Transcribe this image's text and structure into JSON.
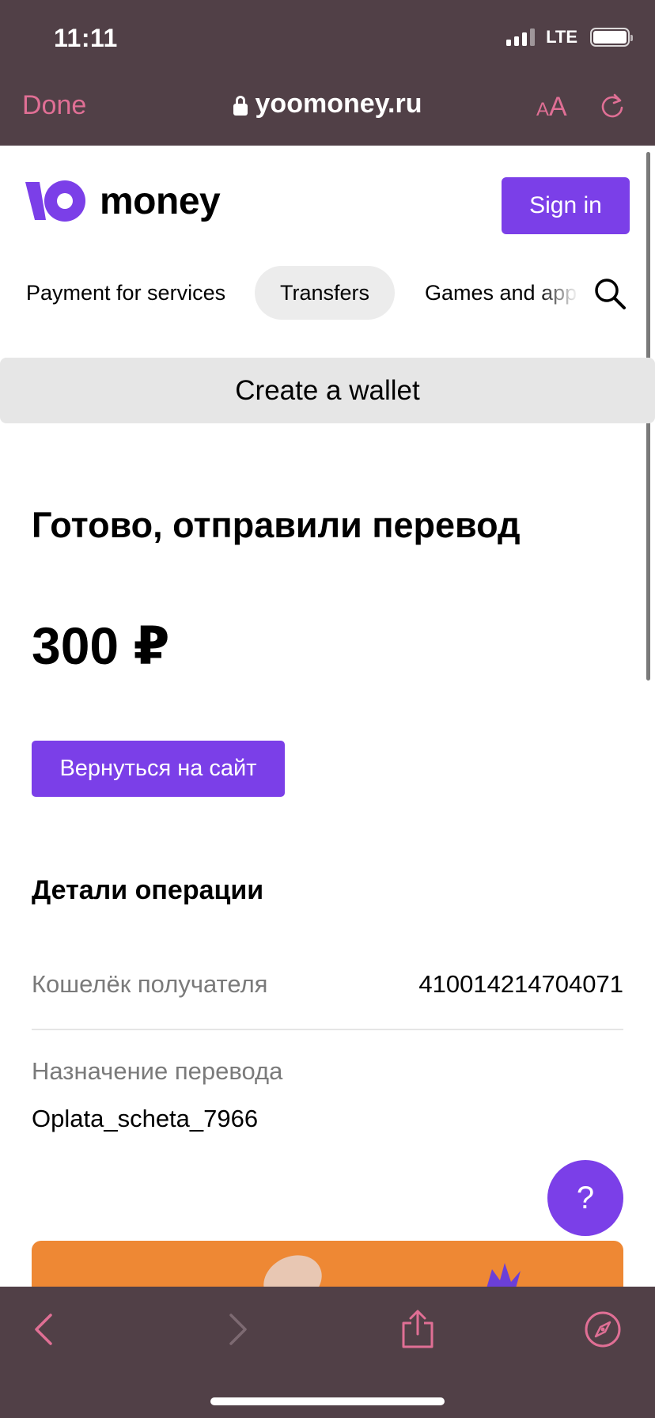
{
  "status_bar": {
    "time": "11:11",
    "network": "LTE"
  },
  "browser": {
    "done_label": "Done",
    "url": "yoomoney.ru",
    "text_size_label_small": "A",
    "text_size_label_large": "A"
  },
  "header": {
    "logo_text": "money",
    "sign_in_label": "Sign in"
  },
  "nav": {
    "items": [
      {
        "label": "Payment for services"
      },
      {
        "label": "Transfers"
      },
      {
        "label": "Games and app"
      }
    ],
    "active_index": 1
  },
  "banner": {
    "create_wallet_label": "Create a wallet"
  },
  "main": {
    "title": "Готово, отправили перевод",
    "amount": "300 ₽",
    "return_button_label": "Вернуться на сайт",
    "details_title": "Детали операции",
    "recipient_wallet_label": "Кошелёк получателя",
    "recipient_wallet_value": "410014214704071",
    "purpose_label": "Назначение перевода",
    "purpose_value": "Oplata_scheta_7966"
  },
  "help": {
    "label": "?"
  },
  "colors": {
    "brand_purple": "#7b3fe8",
    "browser_chrome": "#514047",
    "browser_accent": "#e06f95",
    "promo_orange": "#ee8834"
  }
}
